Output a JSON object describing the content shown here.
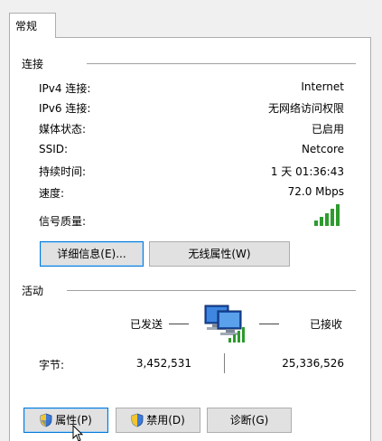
{
  "tab": {
    "label": "常规"
  },
  "connection": {
    "title": "连接",
    "rows": [
      {
        "label": "IPv4 连接:",
        "value": "Internet"
      },
      {
        "label": "IPv6 连接:",
        "value": "无网络访问权限"
      },
      {
        "label": "媒体状态:",
        "value": "已启用"
      },
      {
        "label": "SSID:",
        "value": "Netcore"
      },
      {
        "label": "持续时间:",
        "value": "1 天 01:36:43"
      },
      {
        "label": "速度:",
        "value": "72.0 Mbps"
      }
    ],
    "signal_label": "信号质量:",
    "signal_level": 1.0,
    "details_button": "详细信息(E)...",
    "wireless_button": "无线属性(W)"
  },
  "activity": {
    "title": "活动",
    "sent_label": "已发送",
    "received_label": "已接收",
    "bytes_label": "字节:",
    "bytes_sent": "3,452,531",
    "bytes_received": "25,336,526"
  },
  "buttons": {
    "properties": "属性(P)",
    "disable": "禁用(D)",
    "diagnose": "诊断(G)"
  },
  "colors": {
    "signal_green": "#2e9b2e",
    "focus_blue": "#0078d7"
  }
}
